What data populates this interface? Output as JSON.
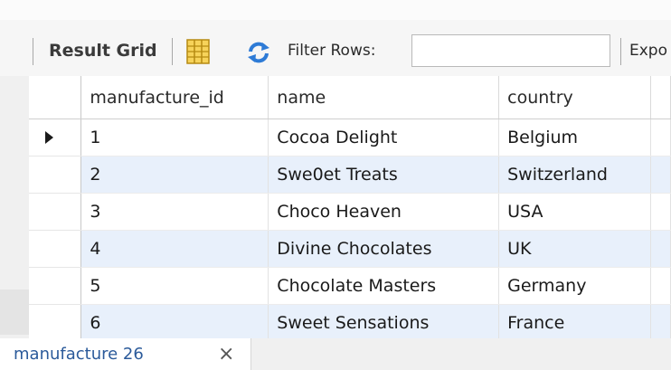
{
  "toolbar": {
    "result_grid_label": "Result Grid",
    "grid_icon": "grid-layout-icon",
    "refresh_icon": "refresh-icon",
    "filter_label": "Filter Rows:",
    "filter_value": "",
    "export_label": "Expo"
  },
  "grid": {
    "columns": [
      "manufacture_id",
      "name",
      "country"
    ],
    "rows": [
      {
        "manufacture_id": "1",
        "name": "Cocoa Delight",
        "country": "Belgium",
        "selected": true
      },
      {
        "manufacture_id": "2",
        "name": "Swe0et Treats",
        "country": "Switzerland"
      },
      {
        "manufacture_id": "3",
        "name": "Choco Heaven",
        "country": "USA"
      },
      {
        "manufacture_id": "4",
        "name": "Divine Chocolates",
        "country": "UK"
      },
      {
        "manufacture_id": "5",
        "name": "Chocolate Masters",
        "country": "Germany"
      },
      {
        "manufacture_id": "6",
        "name": "Sweet Sensations",
        "country": "France"
      }
    ],
    "row_alt_color": "#e8f0fb"
  },
  "tabs": [
    {
      "label": "manufacture 26",
      "close_icon": "close-icon",
      "close_glyph": "×"
    }
  ]
}
